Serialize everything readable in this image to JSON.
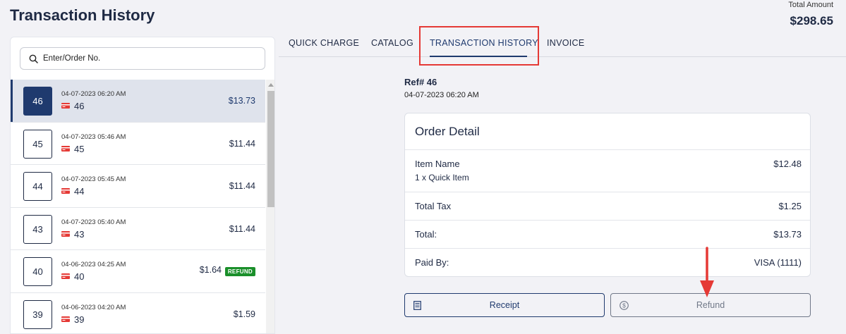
{
  "page": {
    "title": "Transaction History"
  },
  "summary": {
    "total_label": "Total Amount",
    "total_value": "$298.65"
  },
  "search": {
    "placeholder": "Enter/Order No."
  },
  "transactions": [
    {
      "number": "46",
      "date": "04-07-2023 06:20 AM",
      "ref": "46",
      "amount": "$13.73",
      "selected": true
    },
    {
      "number": "45",
      "date": "04-07-2023 05:46 AM",
      "ref": "45",
      "amount": "$11.44"
    },
    {
      "number": "44",
      "date": "04-07-2023 05:45 AM",
      "ref": "44",
      "amount": "$11.44"
    },
    {
      "number": "43",
      "date": "04-07-2023 05:40 AM",
      "ref": "43",
      "amount": "$11.44"
    },
    {
      "number": "40",
      "date": "04-06-2023 04:25 AM",
      "ref": "40",
      "amount": "$1.64",
      "badge": "REFUND"
    },
    {
      "number": "39",
      "date": "04-06-2023 04:20 AM",
      "ref": "39",
      "amount": "$1.59"
    }
  ],
  "tabs": [
    {
      "label": "QUICK CHARGE"
    },
    {
      "label": "CATALOG"
    },
    {
      "label": "TRANSACTION HISTORY",
      "active": true
    },
    {
      "label": "INVOICE"
    }
  ],
  "detail": {
    "ref": "Ref# 46",
    "date": "04-07-2023 06:20 AM",
    "card_title": "Order Detail",
    "item_label": "Item Name",
    "item_value": "$12.48",
    "item_sub": "1 x Quick Item",
    "tax_label": "Total Tax",
    "tax_value": "$1.25",
    "total_label": "Total:",
    "total_value": "$13.73",
    "paid_label": "Paid By:",
    "paid_value": "VISA (1111)"
  },
  "actions": {
    "receipt_label": "Receipt",
    "refund_label": "Refund"
  },
  "colors": {
    "accent": "#1f3a6e",
    "card_red": "#e53935",
    "refund_green": "#1a8f2a",
    "annotation_red": "#e53935"
  }
}
